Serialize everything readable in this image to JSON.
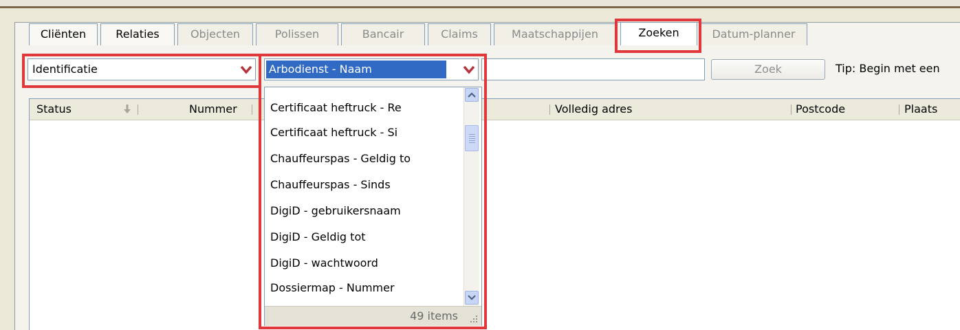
{
  "tabs": [
    {
      "label": "Cliënten",
      "state": "enabled"
    },
    {
      "label": "Relaties",
      "state": "enabled"
    },
    {
      "label": "Objecten",
      "state": "disabled"
    },
    {
      "label": "Polissen",
      "state": "disabled"
    },
    {
      "label": "Bancair",
      "state": "disabled"
    },
    {
      "label": "Claims",
      "state": "disabled"
    },
    {
      "label": "Maatschappijen",
      "state": "disabled"
    },
    {
      "label": "Zoeken",
      "state": "selected"
    },
    {
      "label": "Datum-planner",
      "state": "disabled"
    }
  ],
  "search": {
    "category_value": "Identificatie",
    "field_value": "Arbodienst - Naam",
    "query_value": "",
    "button_label": "Zoek",
    "tip": "Tip: Begin met een"
  },
  "grid_columns": [
    "Status",
    "Nummer",
    "Volledig adres",
    "Postcode",
    "Plaats"
  ],
  "dropdown": {
    "items": [
      "Certificaat heftruck - Re",
      "Certificaat heftruck - Si",
      "Chauffeurspas - Geldig to",
      "Chauffeurspas - Sinds",
      "DigiD - gebruikersnaam",
      "DigiD - Geldig tot",
      "DigiD - wachtwoord",
      "Dossiermap - Nummer"
    ],
    "count_label": "49 items"
  },
  "colors": {
    "highlight": "#e0373b",
    "selection": "#316ac5",
    "chevron": "#b8323b"
  }
}
